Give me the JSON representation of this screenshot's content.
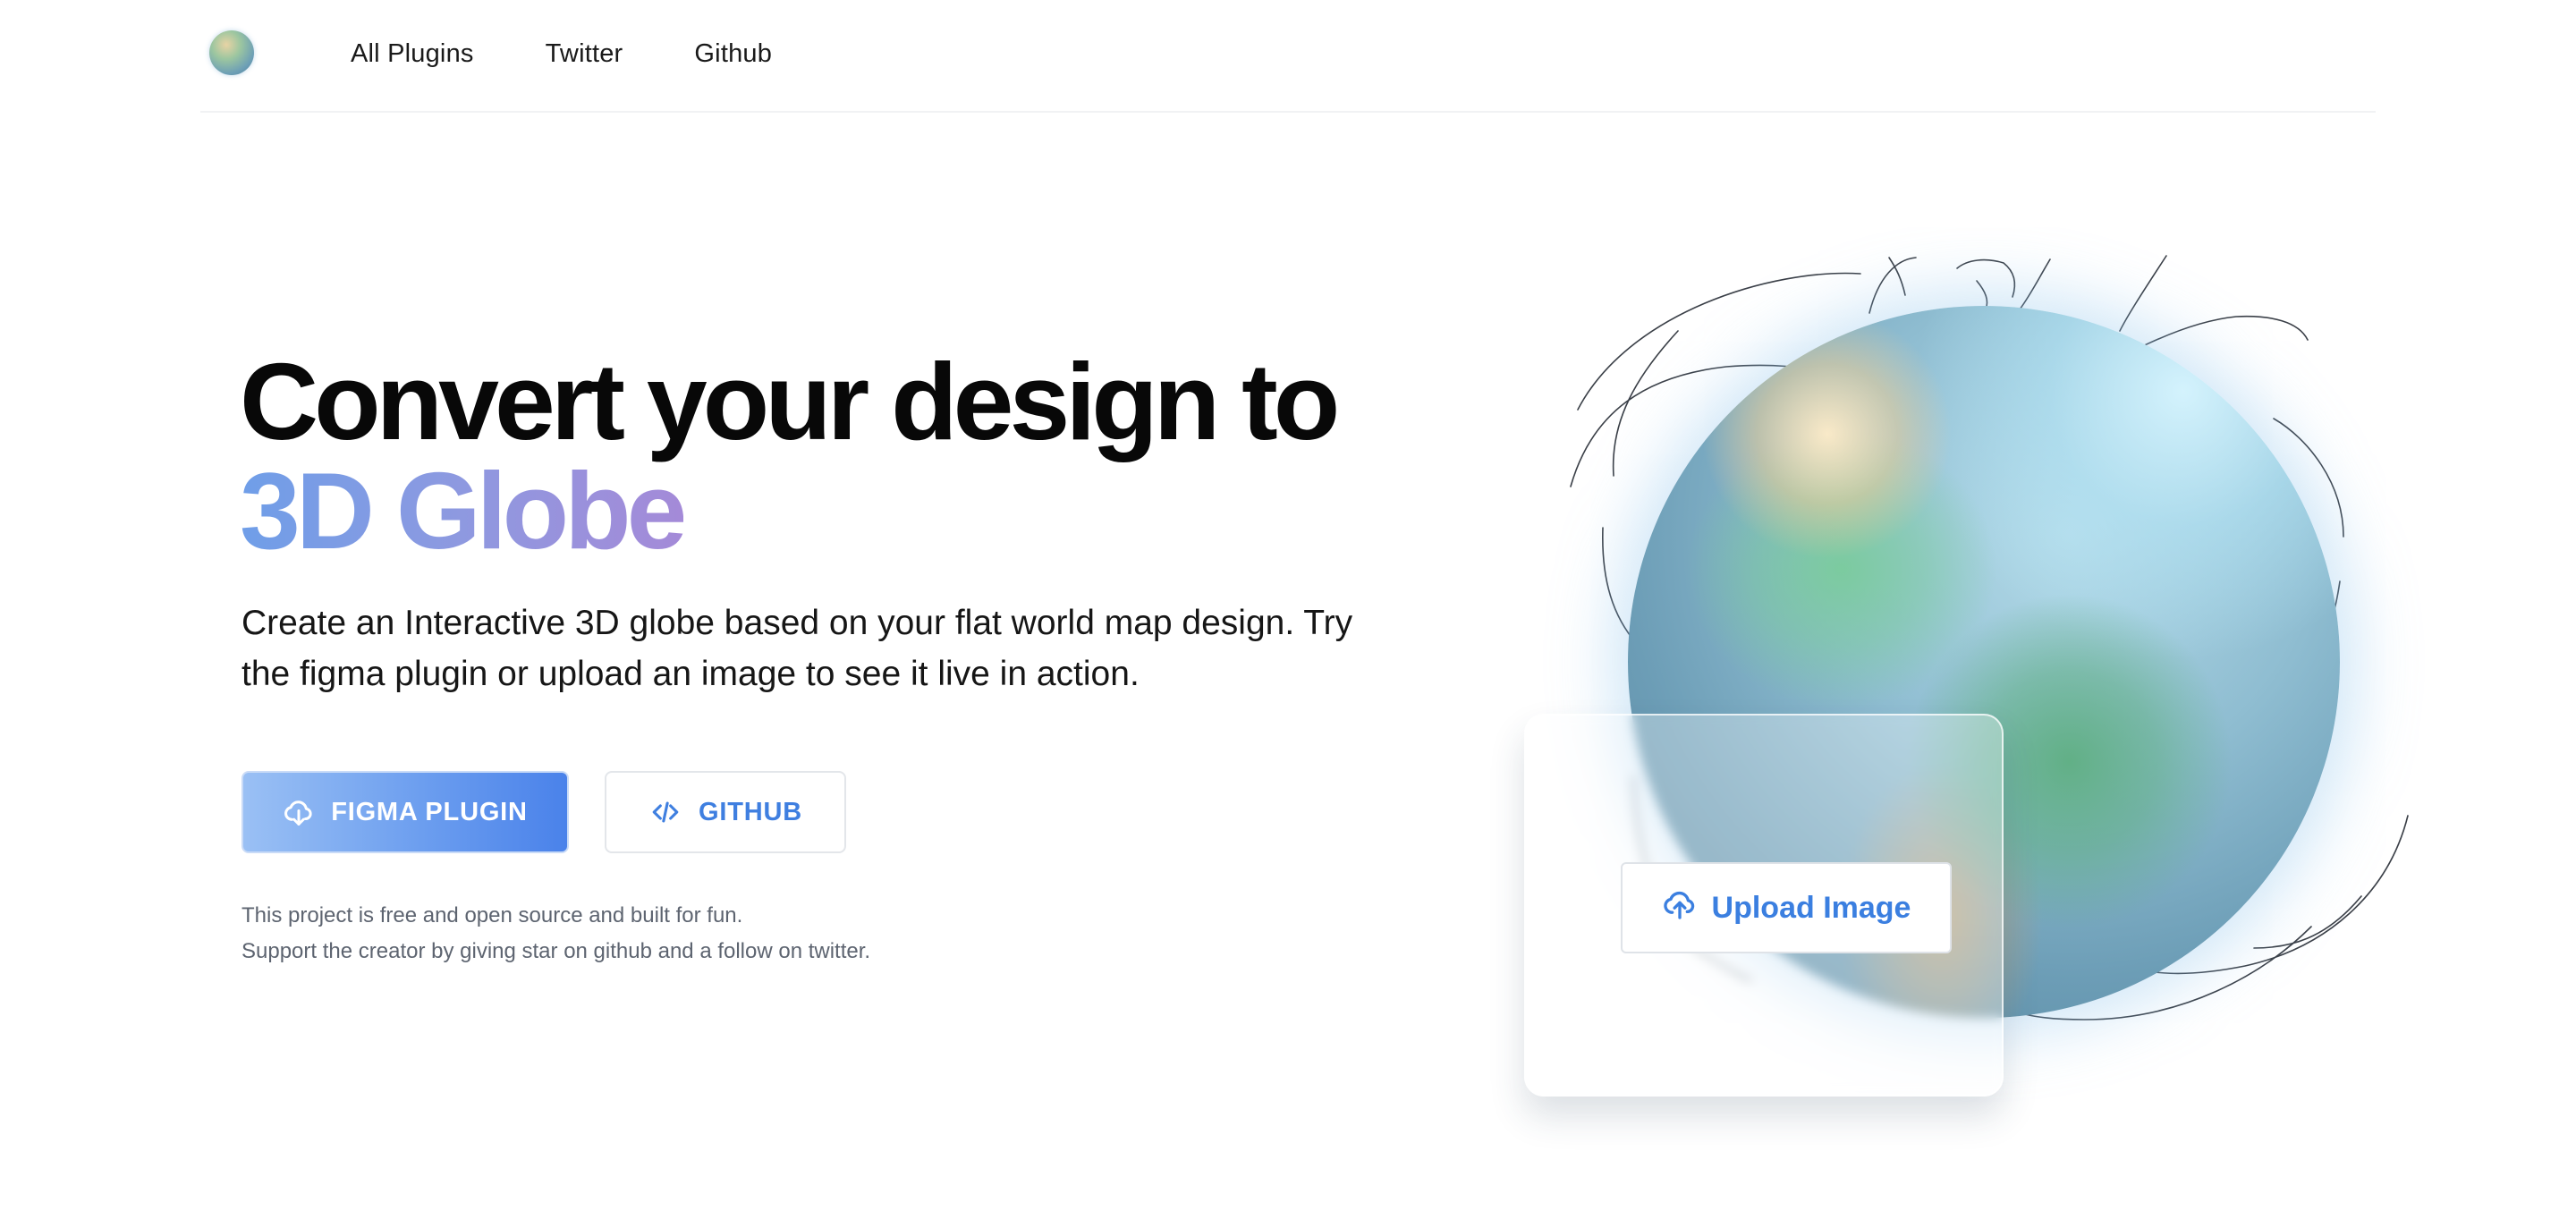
{
  "nav": {
    "logo_icon": "globe-logo-icon",
    "links": [
      "All Plugins",
      "Twitter",
      "Github"
    ]
  },
  "hero": {
    "title_line1": "Convert your design to",
    "title_line2": "3D Globe",
    "subtitle_line1": "Create an Interactive 3D globe based on your flat world map design. Try",
    "subtitle_line2": "the figma plugin or upload an image to see it live in action.",
    "figma_button": {
      "label": "FIGMA PLUGIN",
      "icon": "cloud-download-icon"
    },
    "github_button": {
      "label": "GITHUB",
      "icon": "code-icon"
    },
    "note_line1": "This project is free and open source and built for fun.",
    "note_line2": "Support the creator by giving star on github and a follow on twitter."
  },
  "upload": {
    "label": "Upload Image",
    "icon": "cloud-upload-icon"
  },
  "colors": {
    "accent_blue": "#3f7fe0",
    "gradient_start": "#6f9ee8",
    "gradient_end": "#a48ad8",
    "text_dark": "#080808",
    "note_gray": "#5d6470"
  }
}
